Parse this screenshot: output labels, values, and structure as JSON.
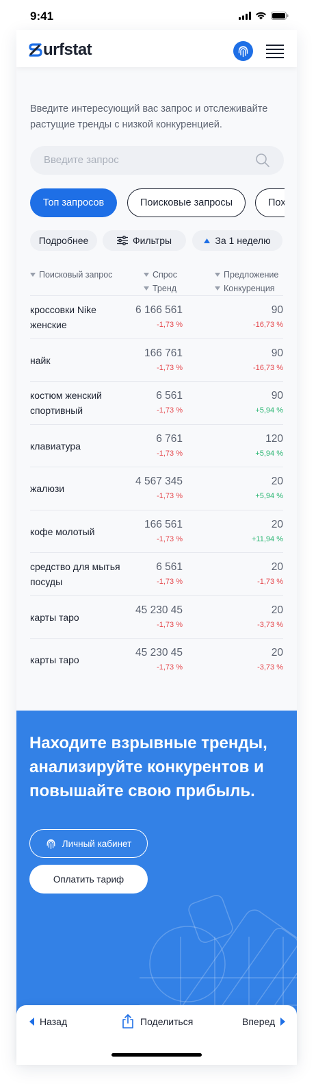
{
  "status": {
    "time": "9:41"
  },
  "header": {
    "logo_text": "urfstat",
    "logo_icon": "surfstat-s-logo",
    "fingerprint_icon": "fingerprint-icon",
    "menu_icon": "hamburger-menu-icon"
  },
  "intro": "Введите интересующий вас запрос и отслеживайте растущие тренды с низкой конкуренцией.",
  "search": {
    "placeholder": "Введите запрос"
  },
  "tabs": [
    {
      "label": "Топ запросов",
      "active": true
    },
    {
      "label": "Поисковые запросы",
      "active": false
    },
    {
      "label": "Пох",
      "active": false
    }
  ],
  "filters": {
    "details": "Подробнее",
    "filters": "Фильтры",
    "period": "За 1 неделю"
  },
  "table": {
    "headers": {
      "query": "Поисковый запрос",
      "demand": "Спрос",
      "trend": "Тренд",
      "offer": "Предложение",
      "competition": "Конкуренция"
    },
    "rows": [
      {
        "query": "кроссовки Nike женские",
        "demand": "6 166 561",
        "trend": "-1,73 %",
        "offer": "90",
        "competition": "-16,73 %",
        "comp_sign": "neg"
      },
      {
        "query": "найк",
        "demand": "166 761",
        "trend": "-1,73 %",
        "offer": "90",
        "competition": "-16,73 %",
        "comp_sign": "neg"
      },
      {
        "query": "костюм женский спортивный",
        "demand": "6 561",
        "trend": "-1,73 %",
        "offer": "90",
        "competition": "+5,94 %",
        "comp_sign": "pos"
      },
      {
        "query": "клавиатура",
        "demand": "6 761",
        "trend": "-1,73 %",
        "offer": "120",
        "competition": "+5,94 %",
        "comp_sign": "pos"
      },
      {
        "query": "жалюзи",
        "demand": "4 567 345",
        "trend": "-1,73 %",
        "offer": "20",
        "competition": "+5,94 %",
        "comp_sign": "pos"
      },
      {
        "query": "кофе молотый",
        "demand": "166 561",
        "trend": "-1,73 %",
        "offer": "20",
        "competition": "+11,94 %",
        "comp_sign": "pos"
      },
      {
        "query": "средство для мытья посуды",
        "demand": "6 561",
        "trend": "-1,73 %",
        "offer": "20",
        "competition": "-1,73 %",
        "comp_sign": "neg"
      },
      {
        "query": "карты таро",
        "demand": "45 230 45",
        "trend": "-1,73 %",
        "offer": "20",
        "competition": "-3,73 %",
        "comp_sign": "neg"
      },
      {
        "query": "карты таро",
        "demand": "45 230 45",
        "trend": "-1,73 %",
        "offer": "20",
        "competition": "-3,73 %",
        "comp_sign": "neg"
      }
    ]
  },
  "promo": {
    "title": "Находите взрывные тренды, анализируйте конкурентов и повышайте свою прибыль.",
    "cabinet_button": "Личный кабинет",
    "pay_button": "Оплатить тариф"
  },
  "bottom_nav": {
    "back": "Назад",
    "share": "Поделиться",
    "forward": "Вперед"
  },
  "colors": {
    "accent": "#1e6fe6",
    "promo_bg": "#3381e6",
    "negative": "#e5484d",
    "positive": "#2bb673"
  }
}
